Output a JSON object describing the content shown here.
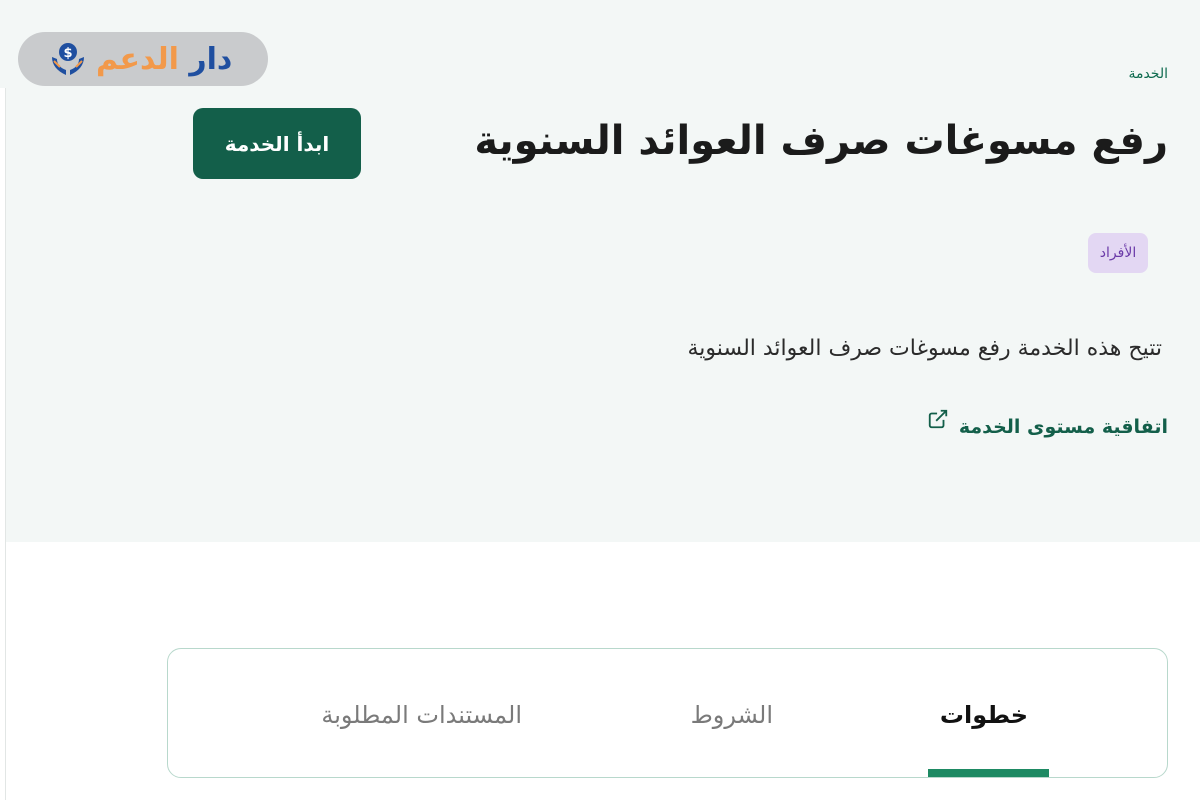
{
  "logo": {
    "word1": "دار",
    "word2": "الدعم",
    "icon": "hands-coin-icon",
    "colors": {
      "primary": "#1f4fa0",
      "secondary": "#f2994a"
    }
  },
  "breadcrumb": {
    "label": "الخدمة"
  },
  "service": {
    "title": "رفع مسوغات صرف العوائد السنوية",
    "start_button": "ابدأ الخدمة",
    "audience_badge": "الأفراد",
    "description": "تتيح هذه الخدمة رفع مسوغات صرف العوائد السنوية",
    "sla_link": "اتفاقية مستوى الخدمة",
    "sla_icon": "external-link-icon"
  },
  "tabs": {
    "items": [
      {
        "label": "خطوات",
        "active": true
      },
      {
        "label": "الشروط",
        "active": false
      },
      {
        "label": "المستندات المطلوبة",
        "active": false
      }
    ]
  },
  "colors": {
    "brand_green": "#135f4a",
    "accent_green": "#1e8a63",
    "hero_background": "#f3f7f6",
    "badge_background": "#e3d7f3",
    "badge_text": "#6b3aa8"
  }
}
